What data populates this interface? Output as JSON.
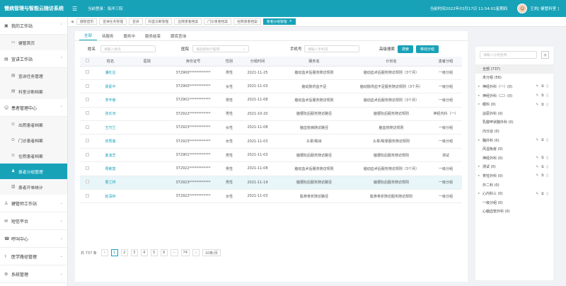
{
  "topbar": {
    "title": "慢病管理与智能云随访系统",
    "current_login_label": "当前登录：海洋三院",
    "datetime": "当前时间2022年03月17日 11:54:01星期四",
    "user": "王凯[ 健管科室 ]"
  },
  "sidebar": {
    "groups": [
      {
        "label": "我的工作站",
        "icon": "workstation-icon",
        "items": [
          {
            "label": "健管首页",
            "icon": "monitor-icon"
          }
        ]
      },
      {
        "label": "宣讲工作站",
        "icon": "speaker-icon",
        "items": [
          {
            "label": "宣讲任务管理",
            "icon": "doc-icon"
          },
          {
            "label": "科室诊断档案",
            "icon": "doc-icon"
          }
        ]
      },
      {
        "label": "患者管理中心",
        "icon": "patient-icon",
        "items": [
          {
            "label": "出院患者档案",
            "icon": "record-icon"
          },
          {
            "label": "门诊患者档案",
            "icon": "record-icon"
          },
          {
            "label": "住院患者档案",
            "icon": "record-icon"
          },
          {
            "label": "患者分组管理",
            "icon": "group-icon",
            "active": true
          },
          {
            "label": "患者开单统计",
            "icon": "chart-icon"
          }
        ]
      },
      {
        "label": "健管师工作站",
        "icon": "manager-icon",
        "items": []
      },
      {
        "label": "短信平台",
        "icon": "sms-icon",
        "items": []
      },
      {
        "label": "呼叫中心",
        "icon": "call-icon",
        "items": []
      },
      {
        "label": "医学路径管理",
        "icon": "path-icon",
        "items": []
      },
      {
        "label": "系统管理",
        "icon": "settings-icon",
        "items": []
      }
    ]
  },
  "page_tabs": [
    "健管首页",
    "宣讲任务管理",
    "宣讲",
    "科室诊断管理",
    "出院患者档案",
    "门诊患者档案",
    "住院患者档案",
    "患者分组管理"
  ],
  "subtabs": [
    "全部",
    "待服务",
    "服务中",
    "服务结束",
    "跟库查询"
  ],
  "filters": {
    "name_label": "姓名",
    "name_placeholder": "请输入姓名",
    "hospital_label": "医院",
    "hospital_placeholder": "请选择执行医院",
    "phone_label": "手机号",
    "phone_placeholder": "请输入手机号",
    "advanced": "高级搜索",
    "search_btn": "搜索",
    "move_btn": "移动分组"
  },
  "table": {
    "headers": [
      "",
      "姓名",
      "医院",
      "身份证号",
      "性别",
      "分组时间",
      "服务名",
      "计划名",
      "患者分组"
    ],
    "rows": [
      [
        "",
        "潘杜庄",
        "",
        "372900************",
        "男性",
        "2021-11-25",
        "脑动血术后服务随访规则",
        "脑动血术后服务随访规则（3个月）",
        "一级分组"
      ],
      [
        "",
        "梁素平",
        "",
        "372900************",
        "女性",
        "2021-11-03",
        "脑动脉供血不足",
        "脑动脉供血不足服务随访规则（3个月）",
        "一级分组"
      ],
      [
        "",
        "李丰南",
        "",
        "372901************",
        "男性",
        "2021-11-08",
        "脑动血术后服务随访规则",
        "脑动血术后服务随访规则（3个月）",
        "一级分组"
      ],
      [
        "",
        "张长河",
        "",
        "372922************",
        "男性",
        "2021-10-20",
        "脑梗阮后服务随访路径",
        "脑梗阮后服务随访规则",
        "神经内科（一）"
      ],
      [
        "",
        "王巧兰",
        "",
        "372923************",
        "女性",
        "2021-11-08",
        "脑血管病随访路径",
        "脑血管随访规则",
        "一级分组"
      ],
      [
        "",
        "张秀莲",
        "",
        "372923************",
        "女性",
        "2021-11-03",
        "头晕/眩目",
        "头晕/眩晕服务随访规则",
        "一级分组"
      ],
      [
        "",
        "夏凌芝",
        "",
        "372901************",
        "男性",
        "2021-11-03",
        "脑梗阮后服务随访路径",
        "脑梗阮后服务随访规则",
        "测试"
      ],
      [
        "",
        "周敏富",
        "",
        "372922************",
        "男性",
        "2021-11-08",
        "脑动血术后服务随访规则",
        "脑动血术后服务随访规则（3个月）",
        "一级分组"
      ],
      [
        "",
        "曹兰林",
        "",
        "372923************",
        "男性",
        "2021-11-19",
        "脑梗阮后服务随访路径",
        "脑梗阮后服务随访规则",
        "一级分组"
      ],
      [
        "",
        "赵深存",
        "",
        "372922************",
        "女性",
        "2021-11-03",
        "肱骨骨折随访路径",
        "肱骨骨折随访服务随访规则",
        "一级分组"
      ]
    ]
  },
  "pager": {
    "total": "共 737 条",
    "pages": [
      "1",
      "2",
      "3",
      "4",
      "5",
      "6",
      "···",
      "74"
    ],
    "size": "10条/页"
  },
  "tree": {
    "search_placeholder": "请输入分组名称",
    "nodes": [
      {
        "label": "全部 (737)",
        "sel": true
      },
      {
        "label": "未分组 (56)"
      },
      {
        "label": "神经外科（一）(0)",
        "exp": true,
        "acts": true
      },
      {
        "label": "神经外科（二）(0)",
        "exp": true,
        "acts": true
      },
      {
        "label": "眼科 (0)",
        "exp": true,
        "acts": true
      },
      {
        "label": "泌尿外科 (0)"
      },
      {
        "label": "乳腺甲状腺外科 (0)"
      },
      {
        "label": "内分泌 (0)"
      },
      {
        "label": "胸外科 (0)",
        "exp": true,
        "acts": true
      },
      {
        "label": "风湿免疫 (0)"
      },
      {
        "label": "神经外科 (0)",
        "acts": true
      },
      {
        "label": "测试 (0)",
        "exp": true,
        "acts": true
      },
      {
        "label": "脊柱外科 (0)",
        "exp": true,
        "acts": true
      },
      {
        "label": "外二科 (0)"
      },
      {
        "label": "心内科三 (0)",
        "exp": true,
        "acts": true
      },
      {
        "label": "一级分组 (0)"
      },
      {
        "label": "心脑血管外科 (0)"
      }
    ]
  }
}
